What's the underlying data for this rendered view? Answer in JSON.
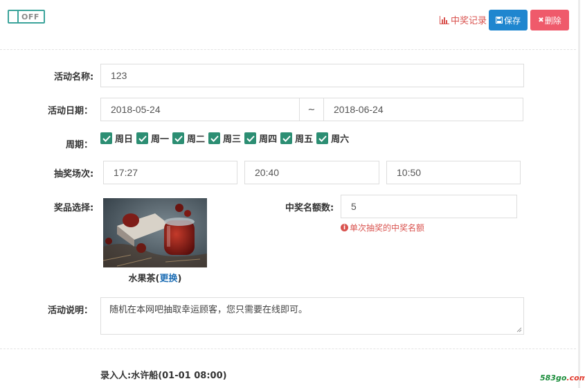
{
  "toggle": {
    "label": "OFF"
  },
  "header": {
    "record_label": "中奖记录",
    "save_label": "保存",
    "delete_label": "删除",
    "colors": {
      "save": "#1f86cf",
      "delete": "#ef5a6b",
      "record": "#d9534f",
      "accent": "#2c8e73"
    }
  },
  "form": {
    "name": {
      "label": "活动名称:",
      "value": "123"
    },
    "date": {
      "label": "活动日期：",
      "start": "2018-05-24",
      "separator": "~",
      "end": "2018-06-24"
    },
    "weekdays": {
      "label": "周期：",
      "days": [
        {
          "label": "周日",
          "checked": true
        },
        {
          "label": "周一",
          "checked": true
        },
        {
          "label": "周二",
          "checked": true
        },
        {
          "label": "周三",
          "checked": true
        },
        {
          "label": "周四",
          "checked": true
        },
        {
          "label": "周五",
          "checked": true
        },
        {
          "label": "周六",
          "checked": true
        }
      ]
    },
    "sessions": {
      "label": "抽奖场次:",
      "times": [
        "17:27",
        "20:40",
        "10:50"
      ]
    },
    "prize": {
      "label": "奖品选择:",
      "name": "水果茶",
      "change_link": "更换",
      "paren_open": "(",
      "paren_close": ")"
    },
    "winners": {
      "label": "中奖名额数:",
      "value": "5",
      "hint": "单次抽奖的中奖名额"
    },
    "description": {
      "label": "活动说明：",
      "value": "随机在本网吧抽取幸运顾客，您只需要在线即可。"
    }
  },
  "footer": {
    "entry": "录入人:水许船(01-01 08:00)"
  },
  "watermark": {
    "part1": "583go",
    "part2": ".com"
  }
}
